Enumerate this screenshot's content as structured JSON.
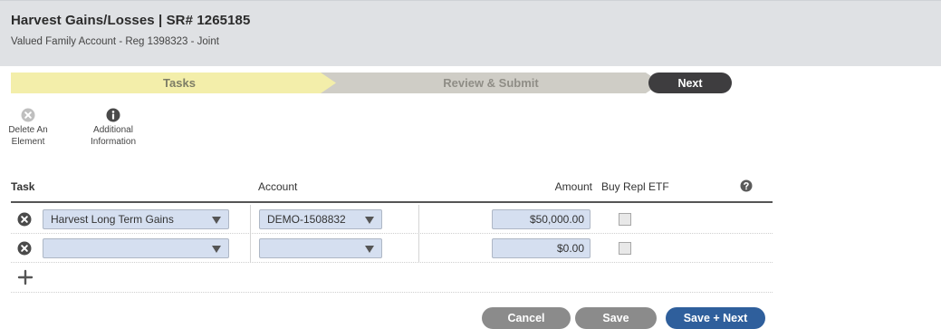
{
  "header": {
    "title": "Harvest Gains/Losses | SR# 1265185",
    "subtitle": "Valued Family Account - Reg 1398323 - Joint"
  },
  "steps": {
    "tasks": "Tasks",
    "review": "Review & Submit",
    "next": "Next"
  },
  "toolbar": {
    "delete_line1": "Delete An",
    "delete_line2": "Element",
    "info_line1": "Additional",
    "info_line2": "Information"
  },
  "columns": {
    "task": "Task",
    "account": "Account",
    "amount": "Amount",
    "buy_repl": "Buy Repl ETF"
  },
  "rows": [
    {
      "task": "Harvest Long Term Gains",
      "account": "DEMO-1508832",
      "amount": "$50,000.00",
      "buy_repl_etf": false
    },
    {
      "task": "",
      "account": "",
      "amount": "$0.00",
      "buy_repl_etf": false
    }
  ],
  "buttons": {
    "cancel": "Cancel",
    "save": "Save",
    "save_next": "Save + Next"
  },
  "colors": {
    "accent_blue": "#2f5f9c",
    "step_active": "#f3eeaa",
    "field_bg": "#d5dff0"
  },
  "icons": {
    "delete": "x-circle-icon",
    "info": "info-circle-icon",
    "help": "question-circle-icon",
    "remove_row": "x-circle-icon",
    "add_row": "plus-icon"
  }
}
